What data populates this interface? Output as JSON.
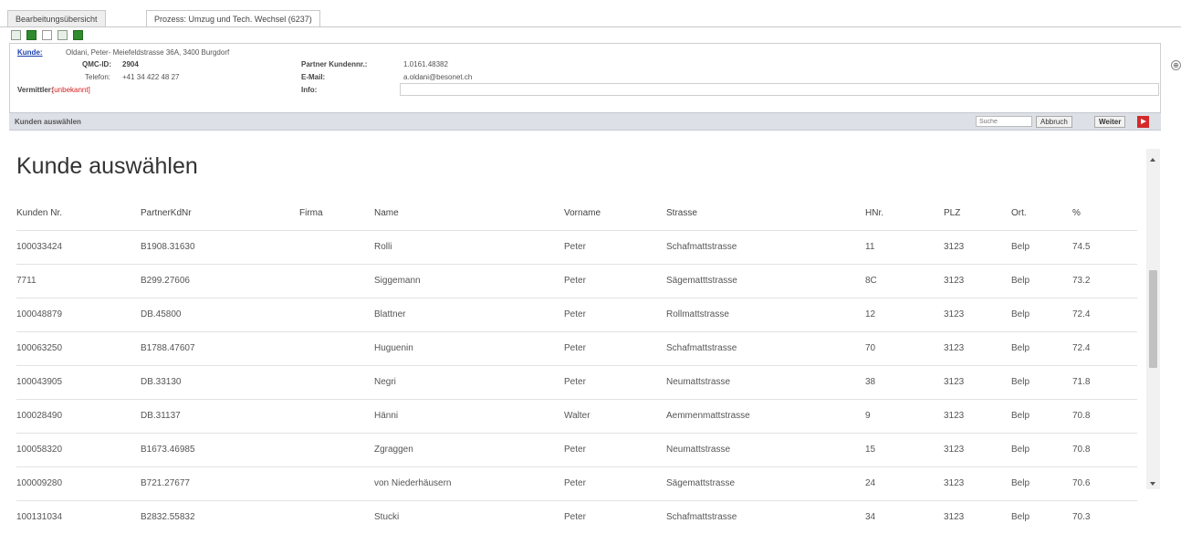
{
  "tabs": [
    {
      "label": "Bearbeitungsübersicht"
    },
    {
      "label": "Prozess: Umzug und Tech. Wechsel (6237)"
    }
  ],
  "customer": {
    "label": "Kunde:",
    "value": "Oldani, Peter- Meiefeldstrasse 36A, 3400 Burgdorf",
    "qmc_label": "QMC-ID:",
    "qmc_value": "2904",
    "phone_label": "Telefon:",
    "phone_value": "+41 34 422 48 27",
    "broker_label": "Vermittler:",
    "broker_value": "[unbekannt]",
    "partner_label": "Partner Kundennr.:",
    "partner_value": "1.0161.48382",
    "email_label": "E-Mail:",
    "email_value": "a.oldani@besonet.ch",
    "info_label": "Info:",
    "info_value": ""
  },
  "section_bar": {
    "title": "Kunden auswählen",
    "search_placeholder": "Suche",
    "cancel_label": "Abbruch",
    "next_label": "Weiter"
  },
  "page_title": "Kunde auswählen",
  "table": {
    "columns": [
      "Kunden Nr.",
      "PartnerKdNr",
      "Firma",
      "Name",
      "Vorname",
      "Strasse",
      "HNr.",
      "PLZ",
      "Ort.",
      "%"
    ],
    "rows": [
      [
        "100033424",
        "B1908.31630",
        "",
        "Rolli",
        "Peter",
        "Schafmattstrasse",
        "11",
        "3123",
        "Belp",
        "74.5"
      ],
      [
        "7711",
        "B299.27606",
        "",
        "Siggemann",
        "Peter",
        "Sägematttstrasse",
        "8C",
        "3123",
        "Belp",
        "73.2"
      ],
      [
        "100048879",
        "DB.45800",
        "",
        "Blattner",
        "Peter",
        "Rollmattstrasse",
        "12",
        "3123",
        "Belp",
        "72.4"
      ],
      [
        "100063250",
        "B1788.47607",
        "",
        "Huguenin",
        "Peter",
        "Schafmattstrasse",
        "70",
        "3123",
        "Belp",
        "72.4"
      ],
      [
        "100043905",
        "DB.33130",
        "",
        "Negri",
        "Peter",
        "Neumattstrasse",
        "38",
        "3123",
        "Belp",
        "71.8"
      ],
      [
        "100028490",
        "DB.31137",
        "",
        "Hänni",
        "Walter",
        "Aemmenmattstrasse",
        "9",
        "3123",
        "Belp",
        "70.8"
      ],
      [
        "100058320",
        "B1673.46985",
        "",
        "Zgraggen",
        "Peter",
        "Neumattstrasse",
        "15",
        "3123",
        "Belp",
        "70.8"
      ],
      [
        "100009280",
        "B721.27677",
        "",
        "von Niederhäusern",
        "Peter",
        "Sägemattstrasse",
        "24",
        "3123",
        "Belp",
        "70.6"
      ],
      [
        "100131034",
        "B2832.55832",
        "",
        "Stucki",
        "Peter",
        "Schafmattstrasse",
        "34",
        "3123",
        "Belp",
        "70.3"
      ]
    ]
  }
}
